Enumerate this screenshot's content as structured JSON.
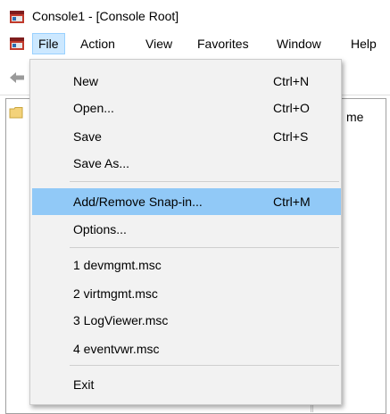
{
  "window": {
    "title": "Console1 - [Console Root]"
  },
  "menubar": {
    "items": [
      {
        "label": "File",
        "open": true
      },
      {
        "label": "Action"
      },
      {
        "label": "View"
      },
      {
        "label": "Favorites"
      },
      {
        "label": "Window"
      },
      {
        "label": "Help"
      }
    ]
  },
  "content": {
    "column_header_fragment": "me"
  },
  "file_menu": {
    "items": [
      {
        "label": "New",
        "shortcut": "Ctrl+N"
      },
      {
        "label": "Open...",
        "shortcut": "Ctrl+O"
      },
      {
        "label": "Save",
        "shortcut": "Ctrl+S"
      },
      {
        "label": "Save As...",
        "shortcut": ""
      },
      {
        "label": "Add/Remove Snap-in...",
        "shortcut": "Ctrl+M",
        "highlighted": true
      },
      {
        "label": "Options...",
        "shortcut": ""
      },
      {
        "label": "1 devmgmt.msc",
        "shortcut": ""
      },
      {
        "label": "2 virtmgmt.msc",
        "shortcut": ""
      },
      {
        "label": "3 LogViewer.msc",
        "shortcut": ""
      },
      {
        "label": "4 eventvwr.msc",
        "shortcut": ""
      },
      {
        "label": "Exit",
        "shortcut": ""
      }
    ]
  },
  "colors": {
    "highlight": "#91c9f7",
    "menu_background": "#f2f2f2",
    "open_menu_background": "#cce8ff"
  },
  "icons": [
    "mmc-console-icon",
    "system-menu-icon",
    "back-arrow-icon",
    "folder-icon"
  ]
}
